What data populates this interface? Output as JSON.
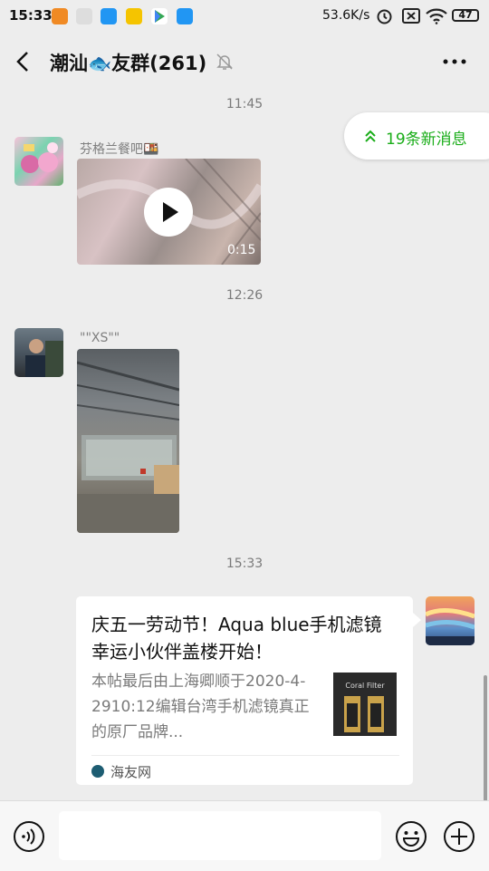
{
  "status_bar": {
    "time": "15:33",
    "network_speed": "53.6K/s",
    "battery": "47",
    "icons": [
      "alarm-icon",
      "sim-icon",
      "wifi-icon",
      "battery-icon"
    ]
  },
  "header": {
    "title": "潮汕🐟友群(261)",
    "icons": [
      "back-icon",
      "mute-icon",
      "more-icon"
    ]
  },
  "new_messages": {
    "label": "19条新消息"
  },
  "messages": [
    {
      "timestamp": "11:45",
      "sender": "芬格兰餐吧🍱",
      "type": "video",
      "duration": "0:15"
    },
    {
      "timestamp": "12:26",
      "sender": "\"\"XS\"\"",
      "type": "image"
    },
    {
      "timestamp": "15:33",
      "type": "link",
      "title": "庆五一劳动节！Aqua blue手机滤镜幸运小伙伴盖楼开始！",
      "description": "本帖最后由上海卿顺于2020-4-2910:12编辑台湾手机滤镜真正的原厂品牌...",
      "thumbnail_text": "Coral Filter",
      "source": "海友网"
    }
  ],
  "input": {
    "value": "",
    "placeholder": ""
  },
  "colors": {
    "accent": "#1aad19",
    "background": "#ededed"
  }
}
